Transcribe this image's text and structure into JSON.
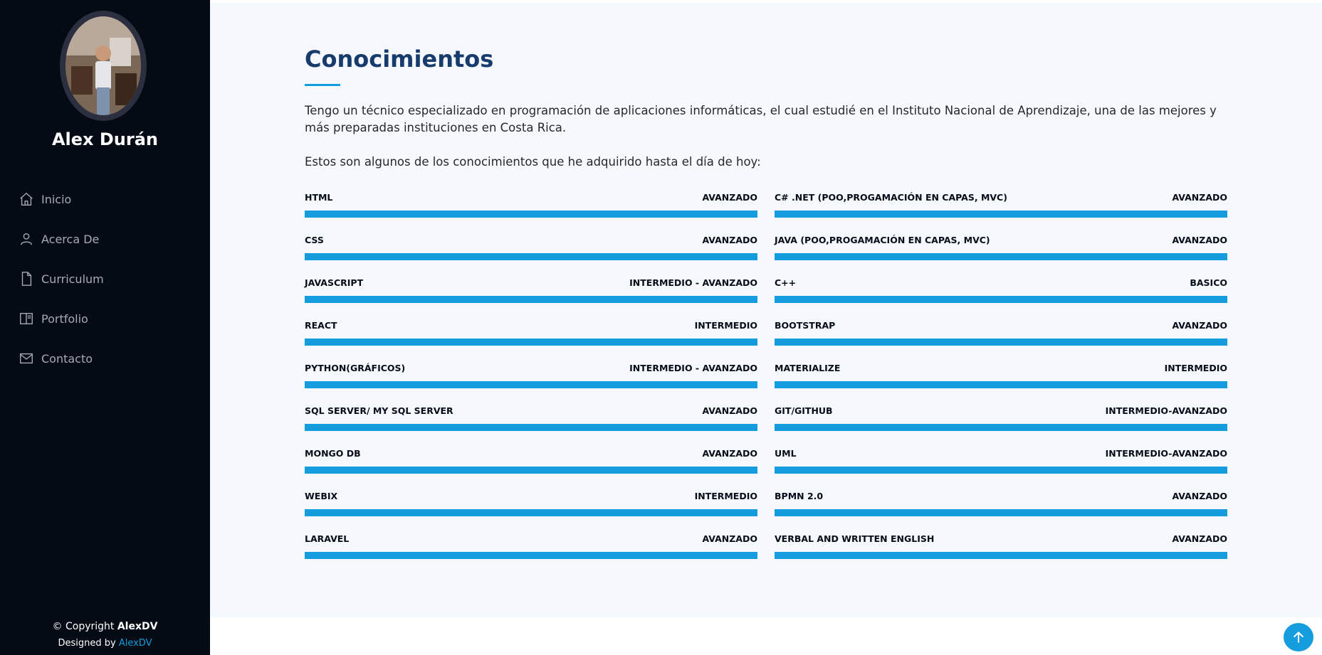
{
  "profile": {
    "name": "Alex Durán"
  },
  "nav": {
    "items": [
      {
        "label": "Inicio",
        "icon": "home-icon"
      },
      {
        "label": "Acerca De",
        "icon": "person-icon"
      },
      {
        "label": "Curriculum",
        "icon": "file-icon"
      },
      {
        "label": "Portfolio",
        "icon": "book-icon"
      },
      {
        "label": "Contacto",
        "icon": "envelope-icon"
      }
    ]
  },
  "footer": {
    "copyright_prefix": "© Copyright ",
    "copyright_name": "AlexDV",
    "designed_prefix": "Designed by ",
    "designed_link": "AlexDV"
  },
  "section": {
    "title": "Conocimientos",
    "paragraph1": "Tengo un técnico especializado en programación de aplicaciones informáticas, el cual estudié en el Instituto Nacional de Aprendizaje, una de las mejores y más preparadas instituciones en Costa Rica.",
    "paragraph2": "Estos son algunos de los conocimientos que he adquirido hasta el día de hoy:"
  },
  "skills_left": [
    {
      "name": "HTML",
      "level": "AVANZADO",
      "progress": 100
    },
    {
      "name": "CSS",
      "level": "AVANZADO",
      "progress": 100
    },
    {
      "name": "JAVASCRIPT",
      "level": "INTERMEDIO - AVANZADO",
      "progress": 100
    },
    {
      "name": "REACT",
      "level": "INTERMEDIO",
      "progress": 100
    },
    {
      "name": "PYTHON(GRÁFICOS)",
      "level": "INTERMEDIO - AVANZADO",
      "progress": 100
    },
    {
      "name": "SQL SERVER/ MY SQL SERVER",
      "level": "AVANZADO",
      "progress": 100
    },
    {
      "name": "MONGO DB",
      "level": "AVANZADO",
      "progress": 100
    },
    {
      "name": "WEBIX",
      "level": "INTERMEDIO",
      "progress": 100
    },
    {
      "name": "LARAVEL",
      "level": "AVANZADO",
      "progress": 100
    }
  ],
  "skills_right": [
    {
      "name": "C# .NET (POO,PROGAMACIÓN EN CAPAS, MVC)",
      "level": "AVANZADO",
      "progress": 100
    },
    {
      "name": "JAVA (POO,PROGAMACIÓN EN CAPAS, MVC)",
      "level": "AVANZADO",
      "progress": 100
    },
    {
      "name": "C++",
      "level": "BASICO",
      "progress": 100
    },
    {
      "name": "BOOTSTRAP",
      "level": "AVANZADO",
      "progress": 100
    },
    {
      "name": "MATERIALIZE",
      "level": "INTERMEDIO",
      "progress": 100
    },
    {
      "name": "GIT/GITHUB",
      "level": "INTERMEDIO-AVANZADO",
      "progress": 100
    },
    {
      "name": "UML",
      "level": "INTERMEDIO-AVANZADO",
      "progress": 100
    },
    {
      "name": "BPMN 2.0",
      "level": "AVANZADO",
      "progress": 100
    },
    {
      "name": "VERBAL AND WRITTEN ENGLISH",
      "level": "AVANZADO",
      "progress": 100
    }
  ],
  "colors": {
    "sidebar_bg": "#040b14",
    "accent": "#149ddd",
    "heading": "#173b6c",
    "main_bg": "#f5f8fd"
  },
  "back_to_top_icon": "arrow-up-icon"
}
